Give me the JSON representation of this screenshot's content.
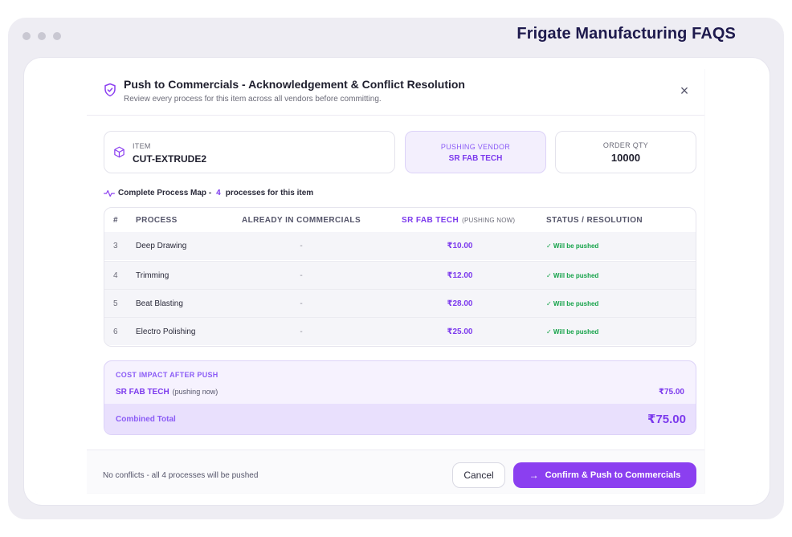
{
  "app": {
    "window_title": "Frigate Manufacturing FAQS"
  },
  "modal": {
    "title": "Push to Commercials - Acknowledgement & Conflict Resolution",
    "subtitle": "Review every process for this item across all vendors before committing.",
    "close_icon": "close-icon"
  },
  "summary": {
    "item_label": "ITEM",
    "item_value": "CUT-EXTRUDE2",
    "vendor_label": "PUSHING VENDOR",
    "vendor_value": "SR FAB TECH",
    "qty_label": "ORDER QTY",
    "qty_value": "10000"
  },
  "process_map": {
    "prefix": "Complete Process Map -",
    "count": "4",
    "suffix": "processes for this item"
  },
  "table": {
    "headers": {
      "num": "#",
      "process": "PROCESS",
      "already": "ALREADY IN COMMERCIALS",
      "vendor": "SR FAB TECH",
      "vendor_hint": "(PUSHING NOW)",
      "status": "STATUS / RESOLUTION"
    },
    "rows": [
      {
        "num": "3",
        "process": "Deep Drawing",
        "already": "-",
        "price": "₹10.00",
        "status": "✓ Will be pushed"
      },
      {
        "num": "4",
        "process": "Trimming",
        "already": "-",
        "price": "₹12.00",
        "status": "✓ Will be pushed"
      },
      {
        "num": "5",
        "process": "Beat Blasting",
        "already": "-",
        "price": "₹28.00",
        "status": "✓ Will be pushed"
      },
      {
        "num": "6",
        "process": "Electro Polishing",
        "already": "-",
        "price": "₹25.00",
        "status": "✓ Will be pushed"
      }
    ]
  },
  "cost": {
    "title": "COST IMPACT AFTER PUSH",
    "vendor": "SR FAB TECH",
    "vendor_note": "(pushing now)",
    "vendor_amount": "₹75.00",
    "total_label": "Combined Total",
    "total_amount": "₹75.00"
  },
  "footer": {
    "note": "No conflicts - all 4 processes will be pushed",
    "cancel_label": "Cancel",
    "confirm_label": "Confirm & Push to Commercials",
    "confirm_icon": "arrow-right-icon"
  },
  "colors": {
    "accent": "#8b3ff0",
    "accent_text": "#7c3aed",
    "success": "#16a34a",
    "title_text": "#1e1a4d"
  }
}
